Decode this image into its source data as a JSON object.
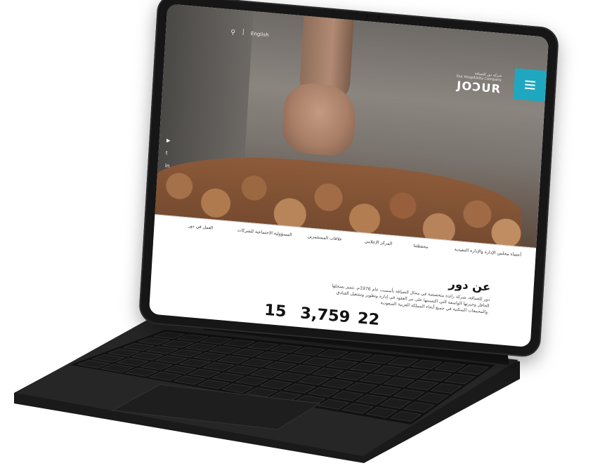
{
  "header": {
    "search_icon": "search-icon",
    "lang_label": "English",
    "brand_logo": "JOƆUR",
    "brand_arabic": "شركة دور للضيافة",
    "brand_tagline": "Dur Hospitality Company",
    "menu_icon": "hamburger-menu-icon",
    "accent_color": "#20a7c0"
  },
  "social": {
    "icons": [
      "youtube-icon",
      "twitter-icon",
      "linkedin-icon"
    ],
    "glyphs": [
      "▶",
      "t",
      "in"
    ]
  },
  "tabs": [
    "أعضاء مجلس الإدارة والإدارة التنفيذية",
    "محفظتنا",
    "المركز الإعلامي",
    "علاقات المستثمرين",
    "المسؤولية الاجتماعية للشركات",
    "العمل في دور"
  ],
  "about": {
    "title": "عن دور",
    "body": "دور للضيافة، شركة رائدة متخصصة في مجال الضيافة تأسست عام 1976م. تتميز بسجلها الحافل وخبرتها الواسعة التي اكتسبتها على مر العقود في إدارة وتطوير وتشغيل الفنادق والمجمعات السكنية في جميع أنحاء المملكة العربية السعودية."
  },
  "stats": [
    "15",
    "3,759",
    "22"
  ]
}
